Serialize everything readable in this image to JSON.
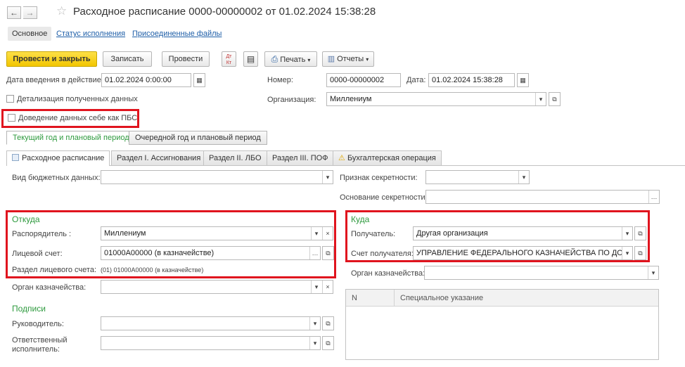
{
  "window": {
    "title": "Расходное расписание 0000-00000002 от 01.02.2024 15:38:28",
    "back": "←",
    "forward": "→",
    "star": "☆"
  },
  "section_tabs": [
    "Основное",
    "Статус исполнения",
    "Присоединенные файлы"
  ],
  "toolbar": {
    "post_close": "Провести и закрыть",
    "save": "Записать",
    "post": "Провести",
    "dtkt": "Дт\nКт",
    "print": "Печать",
    "reports": "Отчеты"
  },
  "header": {
    "date_effective_label": "Дата введения в действие:",
    "date_effective_value": "01.02.2024  0:00:00",
    "number_label": "Номер:",
    "number_value": "0000-00000002",
    "date_label": "Дата:",
    "date_value": "01.02.2024 15:38:28",
    "detail_label": "Детализация полученных данных",
    "org_label": "Организация:",
    "org_value": "Миллениум",
    "pbs_label": "Доведение данных себе как ПБС"
  },
  "period_tabs": [
    "Текущий год и плановый период",
    "Очередной год и плановый период"
  ],
  "doc_tabs": [
    "Расходное расписание",
    "Раздел I. Ассигнования",
    "Раздел II. ЛБО",
    "Раздел III. ПОФ",
    "Бухгалтерская операция"
  ],
  "main": {
    "budget_type_label": "Вид бюджетных данных:",
    "budget_type_value": "",
    "secrecy_label": "Признак секретности:",
    "secrecy_value": "",
    "secrecy_basis_label": "Основание секретности:",
    "secrecy_basis_value": ""
  },
  "from": {
    "title": "Откуда",
    "manager_label": "Распорядитель :",
    "manager_value": "Миллениум",
    "account_label": "Лицевой счет:",
    "account_value": "01000А00000 (в казначействе)",
    "section_label": "Раздел лицевого счета:",
    "section_value": "(01) 01000А00000 (в казначействе)",
    "treasury_label": "Орган казначейства:",
    "treasury_value": ""
  },
  "to": {
    "title": "Куда",
    "recipient_label": "Получатель:",
    "recipient_value": "Другая организация",
    "account_label": "Счет получателя:",
    "account_value": "УПРАВЛЕНИЕ ФЕДЕРАЛЬНОГО КАЗНАЧЕЙСТВА ПО ДОН",
    "treasury_label": "Орган казначейства:",
    "treasury_value": ""
  },
  "signatures": {
    "title": "Подписи",
    "head_label": "Руководитель:",
    "head_value": "",
    "executor_label_1": "Ответственный",
    "executor_label_2": "исполнитель:",
    "executor_value": ""
  },
  "table": {
    "columns": [
      "N",
      "Специальное указание"
    ]
  }
}
